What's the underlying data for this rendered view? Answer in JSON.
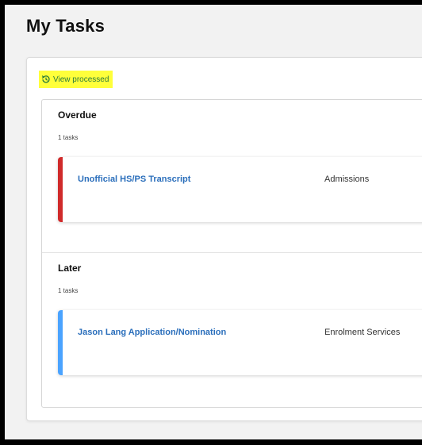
{
  "page": {
    "title": "My Tasks"
  },
  "view_processed": {
    "label": "View processed",
    "icon": "history-icon",
    "highlight_color": "#ffff3a",
    "text_color": "#2a7a3a"
  },
  "colors": {
    "link": "#2a6ebb",
    "overdue_accent": "#d02a2a",
    "later_accent": "#4aa3ff"
  },
  "sections": [
    {
      "title": "Overdue",
      "count": "1 tasks",
      "tasks": [
        {
          "name": "Unofficial HS/PS Transcript",
          "department": "Admissions"
        }
      ]
    },
    {
      "title": "Later",
      "count": "1 tasks",
      "tasks": [
        {
          "name": "Jason Lang Application/Nomination",
          "department": "Enrolment Services"
        }
      ]
    }
  ]
}
